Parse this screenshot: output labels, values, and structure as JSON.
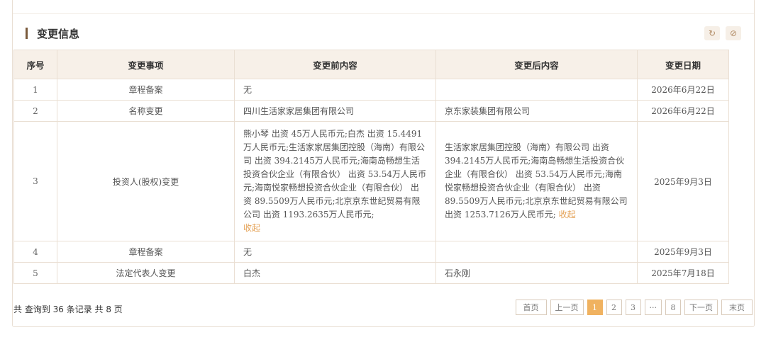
{
  "section": {
    "title": "变更信息",
    "refresh_icon": "refresh-icon",
    "hide_icon": "eye-slash-icon"
  },
  "table": {
    "headers": [
      "序号",
      "变更事项",
      "变更前内容",
      "变更后内容",
      "变更日期"
    ],
    "rows": [
      {
        "idx": "1",
        "item": "章程备案",
        "before": "无",
        "after": "",
        "date": "2026年6月22日"
      },
      {
        "idx": "2",
        "item": "名称变更",
        "before": "四川生活家家居集团有限公司",
        "after": "京东家装集团有限公司",
        "date": "2026年6月22日"
      },
      {
        "idx": "3",
        "item": "投资人(股权)变更",
        "before": "熊小琴 出资 45万人民币元;白杰 出资 15.4491万人民币元;生活家家居集团控股（海南）有限公司 出资 394.2145万人民币元;海南岛畅想生活投资合伙企业（有限合伙） 出资 53.54万人民币元;海南悦家畅想投资合伙企业（有限合伙） 出资 89.5509万人民币元;北京京东世纪贸易有限公司 出资 1193.2635万人民币元;",
        "before_collapse": "收起",
        "after": "生活家家居集团控股（海南）有限公司 出资 394.2145万人民币元;海南岛畅想生活投资合伙企业（有限合伙） 出资 53.54万人民币元;海南悦家畅想投资合伙企业（有限合伙） 出资 89.5509万人民币元;北京京东世纪贸易有限公司 出资 1253.7126万人民币元;",
        "after_collapse": "收起",
        "date": "2025年9月3日"
      },
      {
        "idx": "4",
        "item": "章程备案",
        "before": "无",
        "after": "",
        "date": "2025年9月3日"
      },
      {
        "idx": "5",
        "item": "法定代表人变更",
        "before": "白杰",
        "after": "石永刚",
        "date": "2025年7月18日"
      }
    ]
  },
  "footer": {
    "summary": "共 查询到 36 条记录 共 8 页",
    "pagination": {
      "first": "首页",
      "prev": "上一页",
      "pages": [
        "1",
        "2",
        "3",
        "···",
        "8"
      ],
      "current": "1",
      "next": "下一页",
      "last": "末页"
    }
  },
  "colors": {
    "accent_bar": "#7a5a3c",
    "header_bg": "#f7f0e8",
    "active_page": "#f0b260",
    "collapse_link": "#e4a155"
  }
}
